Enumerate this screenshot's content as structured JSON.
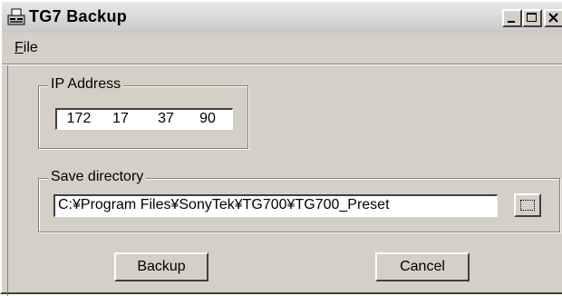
{
  "window": {
    "title": "TG7 Backup",
    "app_icon": "computer-icon",
    "controls": {
      "minimize_icon": "minimize-icon",
      "maximize_icon": "maximize-icon",
      "close_icon": "close-icon"
    }
  },
  "menubar": {
    "items": [
      {
        "mnemonic": "F",
        "rest": "ile"
      }
    ]
  },
  "ip_group": {
    "label": "IP Address",
    "octets": [
      "172",
      "17",
      "37",
      "90"
    ]
  },
  "dir_group": {
    "label": "Save directory",
    "value": "C:¥Program Files¥SonyTek¥TG700¥TG700_Preset",
    "browse_icon": "ellipsis-browse-icon"
  },
  "buttons": {
    "backup_label": "Backup",
    "cancel_label": "Cancel"
  },
  "colors": {
    "face": "#d4d0c8",
    "highlight": "#ffffff",
    "shadow": "#808080",
    "dark_shadow": "#404040"
  }
}
